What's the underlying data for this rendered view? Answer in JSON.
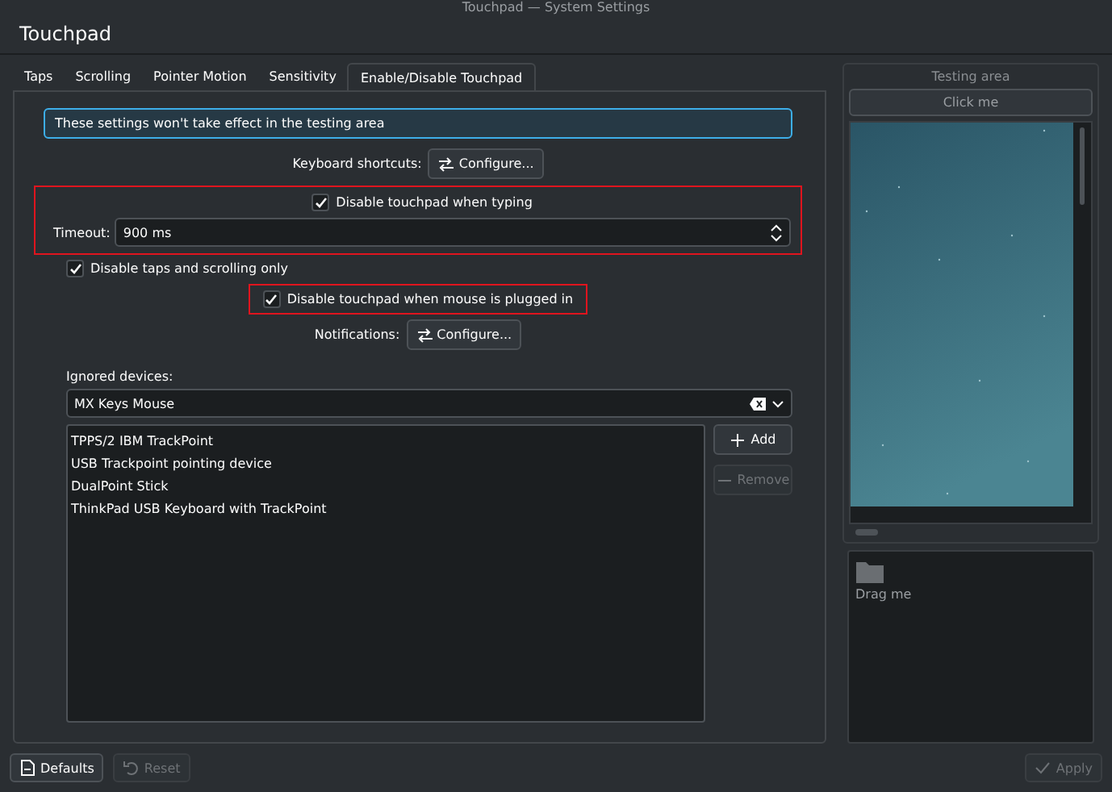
{
  "window": {
    "title": "Touchpad — System Settings"
  },
  "page_title": "Touchpad",
  "tabs": [
    {
      "label": "Taps",
      "selected": false
    },
    {
      "label": "Scrolling",
      "selected": false
    },
    {
      "label": "Pointer Motion",
      "selected": false
    },
    {
      "label": "Sensitivity",
      "selected": false
    },
    {
      "label": "Enable/Disable Touchpad",
      "selected": true
    }
  ],
  "notice": "These settings won't take effect in the testing area",
  "keyboard_shortcuts": {
    "label": "Keyboard shortcuts:",
    "button": "Configure..."
  },
  "typing": {
    "highlighted": true,
    "checkbox": {
      "label": "Disable touchpad when typing",
      "checked": true
    },
    "timeout": {
      "label": "Timeout:",
      "value": "900 ms"
    }
  },
  "taps_only": {
    "label": "Disable taps and scrolling only",
    "checked": true
  },
  "mouse": {
    "highlighted": true,
    "checkbox": {
      "label": "Disable touchpad when mouse is plugged in",
      "checked": true
    }
  },
  "notifications": {
    "label": "Notifications:",
    "button": "Configure..."
  },
  "ignored_devices": {
    "label": "Ignored devices:",
    "combo_value": "MX Keys Mouse",
    "items": [
      "TPPS/2 IBM TrackPoint",
      "USB Trackpoint pointing device",
      "DualPoint Stick",
      "ThinkPad USB Keyboard with TrackPoint"
    ],
    "buttons": [
      {
        "label": "Add",
        "kind": "add",
        "disabled": false
      },
      {
        "label": "Remove",
        "kind": "remove",
        "disabled": true
      }
    ]
  },
  "testing_area": {
    "title": "Testing area",
    "button": "Click me",
    "drag_label": "Drag me"
  },
  "footer": {
    "buttons": [
      {
        "label": "Defaults",
        "kind": "defaults",
        "disabled": false
      },
      {
        "label": "Reset",
        "kind": "reset",
        "disabled": true
      },
      {
        "label": "Apply",
        "kind": "apply",
        "disabled": true
      }
    ]
  }
}
